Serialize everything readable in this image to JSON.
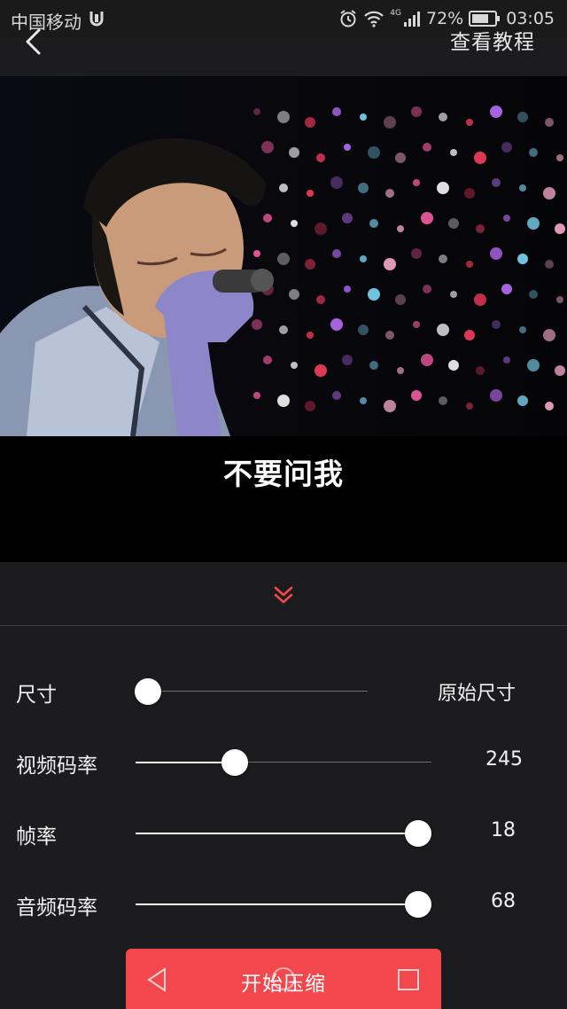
{
  "status_bar": {
    "carrier": "中国移动",
    "network": "4G",
    "battery": "72%",
    "time": "03:05"
  },
  "header": {
    "tutorial_label": "查看教程"
  },
  "video": {
    "subtitle": "不要问我"
  },
  "settings": [
    {
      "label": "尺寸",
      "value": "原始尺寸",
      "slider_fraction": 0.0
    },
    {
      "label": "视频码率",
      "value": "245",
      "slider_fraction": 0.19
    },
    {
      "label": "帧率",
      "value": "18",
      "slider_fraction": 1.0
    },
    {
      "label": "音频码率",
      "value": "68",
      "slider_fraction": 1.0
    }
  ],
  "start_button": {
    "label": "开始压缩"
  },
  "colors": {
    "accent": "#f2474d",
    "background": "#1c1c1e",
    "text": "#f0f0f0"
  },
  "icons": [
    "back-chevron-icon",
    "alarm-icon",
    "wifi-icon",
    "signal-icon",
    "battery-icon",
    "double-chevron-down-icon",
    "nav-back-icon",
    "nav-home-icon",
    "nav-recents-icon"
  ]
}
